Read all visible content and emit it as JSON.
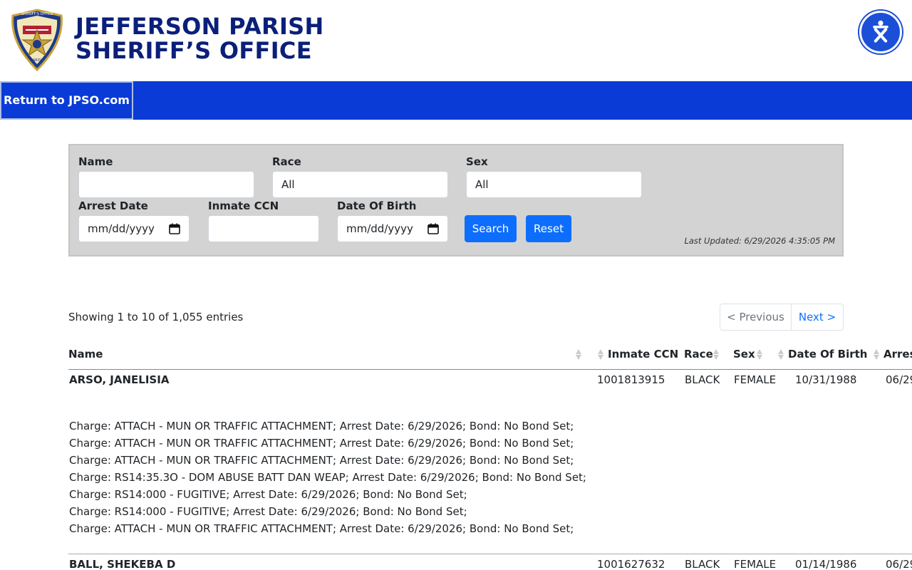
{
  "header": {
    "title_line1": "JEFFERSON PARISH",
    "title_line2": "SHERIFF’S OFFICE",
    "badge_text_top": "SHERIFF'S OFFICE",
    "badge_text_bottom": "PARISH"
  },
  "nav": {
    "return_link": "Return to JPSO.com"
  },
  "filters": {
    "name_label": "Name",
    "name_value": "",
    "race_label": "Race",
    "race_value": "All",
    "sex_label": "Sex",
    "sex_value": "All",
    "arrest_date_label": "Arrest Date",
    "arrest_date_value": "mm/dd/yyyy",
    "ccn_label": "Inmate CCN",
    "ccn_value": "",
    "dob_label": "Date Of Birth",
    "dob_value": "mm/dd/yyyy",
    "search_label": "Search",
    "reset_label": "Reset",
    "last_updated": "Last Updated: 6/29/2026 4:35:05 PM"
  },
  "table_info": {
    "showing": "Showing 1 to 10 of 1,055 entries",
    "prev_label": "< Previous",
    "next_label": "Next >"
  },
  "columns": [
    "Name",
    "Inmate CCN",
    "Race",
    "Sex",
    "Date Of Birth",
    "Arres"
  ],
  "rows": [
    {
      "name": "ARSO, JANELISIA",
      "ccn": "1001813915",
      "race": "BLACK",
      "sex": "FEMALE",
      "dob": "10/31/1988",
      "arrest": "06/29",
      "charges": [
        "Charge: ATTACH - MUN OR TRAFFIC ATTACHMENT; Arrest Date: 6/29/2026; Bond: No Bond Set;",
        "Charge: ATTACH - MUN OR TRAFFIC ATTACHMENT; Arrest Date: 6/29/2026; Bond: No Bond Set;",
        "Charge: ATTACH - MUN OR TRAFFIC ATTACHMENT; Arrest Date: 6/29/2026; Bond: No Bond Set;",
        "Charge: RS14:35.3O - DOM ABUSE BATT DAN WEAP; Arrest Date: 6/29/2026; Bond: No Bond Set;",
        "Charge: RS14:000 - FUGITIVE; Arrest Date: 6/29/2026; Bond: No Bond Set;",
        "Charge: RS14:000 - FUGITIVE; Arrest Date: 6/29/2026; Bond: No Bond Set;",
        "Charge: ATTACH - MUN OR TRAFFIC ATTACHMENT; Arrest Date: 6/29/2026; Bond: No Bond Set;"
      ]
    },
    {
      "name": "BALL, SHEKEBA D",
      "ccn": "1001627632",
      "race": "BLACK",
      "sex": "FEMALE",
      "dob": "01/14/1986",
      "arrest": "06/29"
    }
  ],
  "colors": {
    "brand_navy": "#0b1f7a",
    "nav_blue": "#0a3bd6",
    "button_blue": "#0d6efd",
    "filter_bg": "#d3d3d3"
  },
  "icons": {
    "accessibility": "accessibility-icon",
    "calendar": "calendar-icon",
    "sort": "sort-icon",
    "badge": "sheriff-badge-logo"
  }
}
